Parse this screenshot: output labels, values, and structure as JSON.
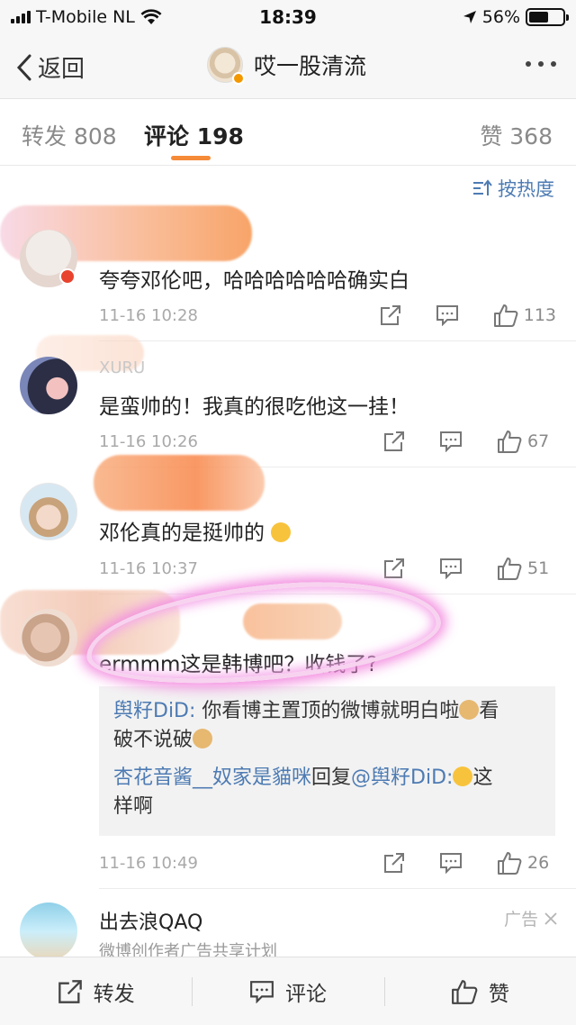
{
  "status_bar": {
    "carrier": "T-Mobile NL",
    "time": "18:39",
    "battery": "56%",
    "battery_level": 0.56
  },
  "nav": {
    "back_label": "返回",
    "title": "哎一股清流",
    "more_icon": "more-dots-icon"
  },
  "tabs": [
    {
      "label": "转发 808"
    },
    {
      "label": "评论 198"
    },
    {
      "label": "赞 368"
    }
  ],
  "sort_label": "按热度",
  "comments": [
    {
      "text": "夸夸邓伦吧，哈哈哈哈哈哈确实白",
      "time": "11-16 10:28",
      "likes": "113"
    },
    {
      "name": "XURU",
      "text": "是蛮帅的！我真的很吃他这一挂！",
      "time": "11-16 10:26",
      "likes": "67"
    },
    {
      "text": "邓伦真的是挺帅的",
      "time": "11-16 10:37",
      "likes": "51"
    },
    {
      "text": "ermmm这是韩博吧？收钱了?",
      "time": "11-16 10:49",
      "likes": "26",
      "replies": [
        {
          "name": "舆籽DiD:",
          "text": " 你看博主置顶的微博就明白啦",
          "text2": "看",
          "line2": "破不说破"
        },
        {
          "name": "杏花音酱__奴家是貓咪",
          "mid": "回复",
          "name2": "@舆籽DiD:",
          "text": "这",
          "line2": "样啊"
        }
      ]
    }
  ],
  "ad": {
    "name": "出去浪QAQ",
    "subtitle": "微博创作者广告共享计划",
    "tag": "广告"
  },
  "bottom_bar": {
    "repost": "转发",
    "comment": "评论",
    "like": "赞"
  },
  "colors": {
    "accent": "#f58a38",
    "link": "#4d7bb3",
    "highlight": "#f38fe0"
  }
}
